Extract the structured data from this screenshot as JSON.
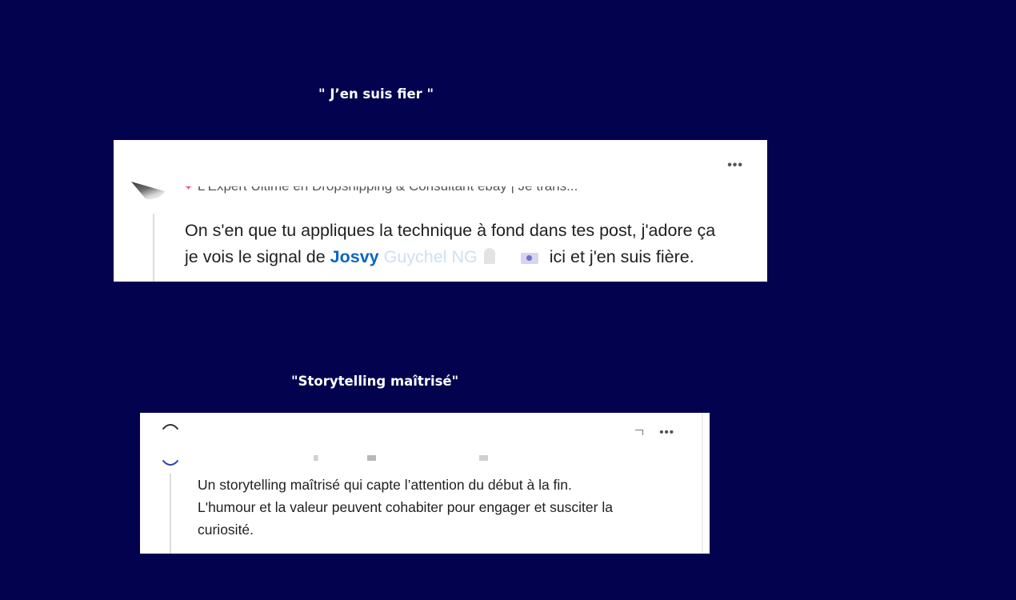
{
  "titles": {
    "first": "\" J’en suis fier \"",
    "second": "\"Storytelling maîtrisé\""
  },
  "comment1": {
    "more_label": "•••",
    "headline": "L'Expert Ultime en Dropshipping & Consultant ebay | Je trans...",
    "line1": "On s'en que tu appliques la technique à fond dans tes post, j'adore ça",
    "line2_before": "je vois le signal de ",
    "mention_first": "Josvy",
    "mention_rest": "Guychel NG",
    "line2_after": "ici et j'en suis fière."
  },
  "comment2": {
    "more_label": "•••",
    "line1": "Un storytelling maîtrisé qui capte l’attention du début à la fin.",
    "line2": "L'humour et la valeur peuvent cohabiter pour engager et susciter la",
    "line3": "curiosité."
  },
  "colors": {
    "background": "#02024f",
    "mention": "#0a66c2"
  },
  "icons": [
    "more-options-icon",
    "pin-icon",
    "person-icon",
    "camera-icon"
  ]
}
